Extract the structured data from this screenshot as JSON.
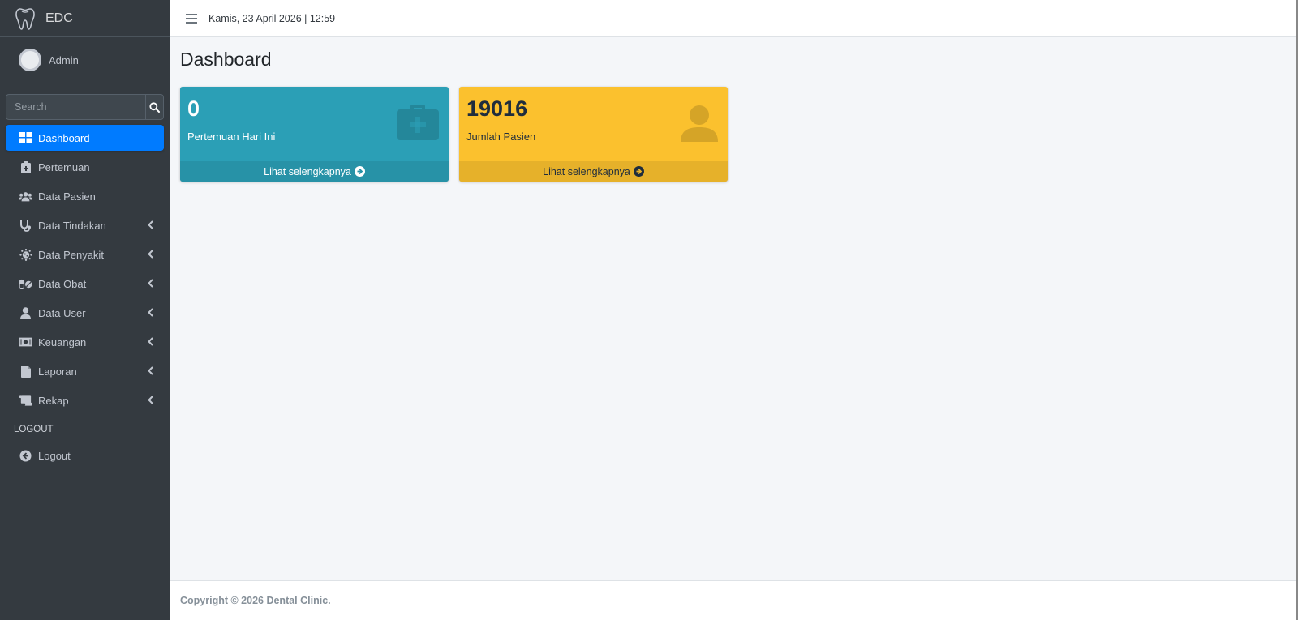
{
  "brand": {
    "name": "EDC"
  },
  "user": {
    "name": "Admin"
  },
  "search": {
    "placeholder": "Search"
  },
  "nav": {
    "items": [
      {
        "label": "Dashboard",
        "icon": "dashboard-icon",
        "active": true,
        "has_submenu": false
      },
      {
        "label": "Pertemuan",
        "icon": "clipboard-medical-icon",
        "has_submenu": false
      },
      {
        "label": "Data Pasien",
        "icon": "users-icon",
        "has_submenu": false
      },
      {
        "label": "Data Tindakan",
        "icon": "stethoscope-icon",
        "has_submenu": true
      },
      {
        "label": "Data Penyakit",
        "icon": "virus-icon",
        "has_submenu": true
      },
      {
        "label": "Data Obat",
        "icon": "pills-icon",
        "has_submenu": true
      },
      {
        "label": "Data User",
        "icon": "user-icon",
        "has_submenu": true
      },
      {
        "label": "Keuangan",
        "icon": "money-bill-icon",
        "has_submenu": true
      },
      {
        "label": "Laporan",
        "icon": "file-icon",
        "has_submenu": true
      },
      {
        "label": "Rekap",
        "icon": "scroll-icon",
        "has_submenu": true
      }
    ],
    "header": "LOGOUT",
    "logout_label": "Logout"
  },
  "topbar": {
    "datetime": "Kamis, 23 April 2026 | 12:59"
  },
  "page": {
    "title": "Dashboard"
  },
  "boxes": [
    {
      "value": "0",
      "label": "Pertemuan Hari Ini",
      "link": "Lihat selengkapnya",
      "color": "#2b9fb6",
      "icon": "medkit-icon"
    },
    {
      "value": "19016",
      "label": "Jumlah Pasien",
      "link": "Lihat selengkapnya",
      "color": "#fbc12e",
      "icon": "user-icon"
    }
  ],
  "footer": {
    "text": "Copyright © 2026 Dental Clinic."
  },
  "colors": {
    "sidebar": "#343a40",
    "active": "#007bff",
    "content_bg": "#f4f6f9"
  }
}
